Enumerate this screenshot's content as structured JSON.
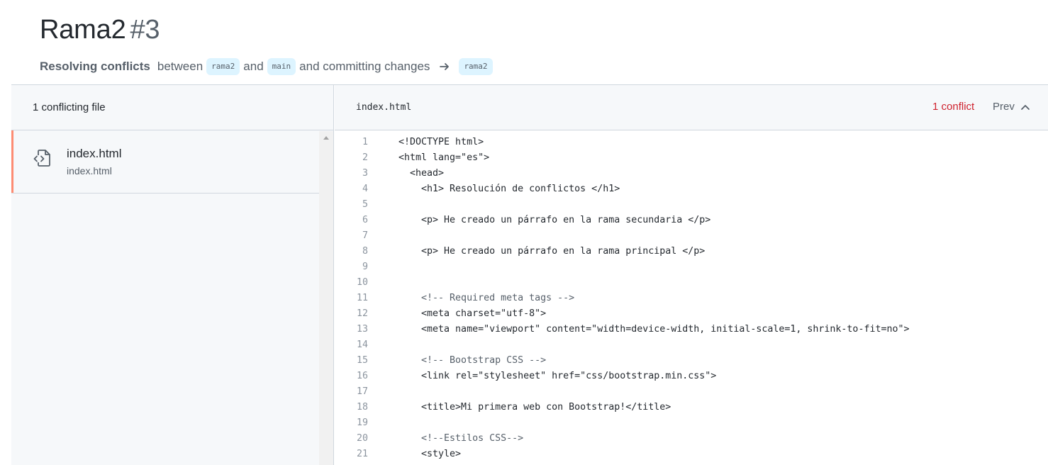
{
  "header": {
    "title": "Rama2",
    "number": "#3",
    "subtitle_strong": "Resolving conflicts",
    "subtitle_between": "between",
    "branch_head": "rama2",
    "subtitle_and": "and",
    "branch_base": "main",
    "subtitle_committing": "and committing changes",
    "target_branch": "rama2"
  },
  "sidebar": {
    "heading": "1 conflicting file",
    "files": [
      {
        "name": "index.html",
        "path": "index.html",
        "icon": "file-code-icon"
      }
    ]
  },
  "editor": {
    "filename": "index.html",
    "conflict_count": "1 conflict",
    "prev_label": "Prev",
    "lines": [
      {
        "n": "1",
        "text": "<!DOCTYPE html>",
        "comment": false
      },
      {
        "n": "2",
        "text": "<html lang=\"es\">",
        "comment": false
      },
      {
        "n": "3",
        "text": "  <head>",
        "comment": false
      },
      {
        "n": "4",
        "text": "    <h1> Resolución de conflictos </h1>",
        "comment": false
      },
      {
        "n": "5",
        "text": "",
        "comment": false
      },
      {
        "n": "6",
        "text": "    <p> He creado un párrafo en la rama secundaria </p>",
        "comment": false
      },
      {
        "n": "7",
        "text": "",
        "comment": false
      },
      {
        "n": "8",
        "text": "    <p> He creado un párrafo en la rama principal </p>",
        "comment": false
      },
      {
        "n": "9",
        "text": "",
        "comment": false
      },
      {
        "n": "10",
        "text": "",
        "comment": false
      },
      {
        "n": "11",
        "text": "    <!-- Required meta tags -->",
        "comment": true
      },
      {
        "n": "12",
        "text": "    <meta charset=\"utf-8\">",
        "comment": false
      },
      {
        "n": "13",
        "text": "    <meta name=\"viewport\" content=\"width=device-width, initial-scale=1, shrink-to-fit=no\">",
        "comment": false
      },
      {
        "n": "14",
        "text": "",
        "comment": false
      },
      {
        "n": "15",
        "text": "    <!-- Bootstrap CSS -->",
        "comment": true
      },
      {
        "n": "16",
        "text": "    <link rel=\"stylesheet\" href=\"css/bootstrap.min.css\">",
        "comment": false
      },
      {
        "n": "17",
        "text": "",
        "comment": false
      },
      {
        "n": "18",
        "text": "    <title>Mi primera web con Bootstrap!</title>",
        "comment": false
      },
      {
        "n": "19",
        "text": "",
        "comment": false
      },
      {
        "n": "20",
        "text": "    <!--Estilos CSS-->",
        "comment": true
      },
      {
        "n": "21",
        "text": "    <style>",
        "comment": false
      }
    ]
  },
  "colors": {
    "conflict_text": "#cf222e",
    "active_marker": "#fd8c73",
    "branch_bg": "#ddf4ff"
  }
}
